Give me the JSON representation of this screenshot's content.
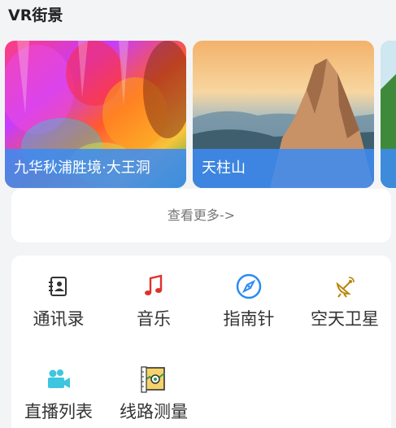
{
  "section": {
    "title": "VR街景"
  },
  "carousel": [
    {
      "caption": "九华秋浦胜境·大王洞"
    },
    {
      "caption": "天柱山"
    },
    {
      "caption": ""
    }
  ],
  "more": {
    "label": "查看更多->"
  },
  "tools": [
    {
      "label": "通讯录",
      "icon": "contacts-icon"
    },
    {
      "label": "音乐",
      "icon": "music-note-icon"
    },
    {
      "label": "指南针",
      "icon": "compass-icon"
    },
    {
      "label": "空天卫星",
      "icon": "satellite-dish-icon"
    },
    {
      "label": "直播列表",
      "icon": "video-camera-icon"
    },
    {
      "label": "线路测量",
      "icon": "map-measure-icon"
    }
  ],
  "colors": {
    "accent": "#3d8bf0",
    "music": "#e0312b",
    "compass": "#2a8bf2",
    "satellite": "#b8860b"
  }
}
